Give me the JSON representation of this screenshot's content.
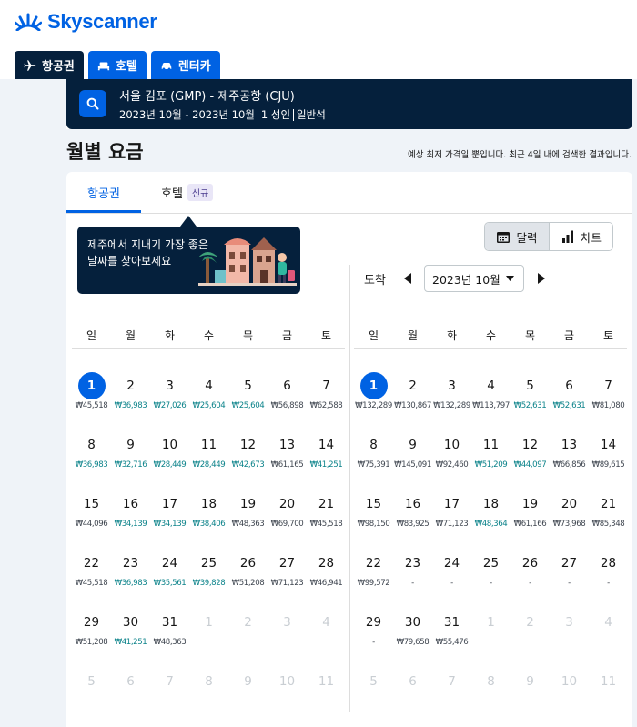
{
  "brand": {
    "name": "Skyscanner",
    "color": "#0062e3"
  },
  "tabs": [
    {
      "label": "항공권",
      "icon": "plane-icon"
    },
    {
      "label": "호텔",
      "icon": "bed-icon"
    },
    {
      "label": "렌터카",
      "icon": "car-icon"
    }
  ],
  "search": {
    "route": "서울 김포 (GMP) - 제주공항 (CJU)",
    "dates": "2023년 10월 - 2023년 10월",
    "passengers": "1 성인",
    "cabin": "일반석"
  },
  "page": {
    "title": "월별 요금",
    "note": "예상 최저 가격일 뿐입니다. 최근 4일 내에 검색한 결과입니다."
  },
  "content_tabs": {
    "flights": "항공권",
    "hotels": "호텔",
    "hotels_badge": "신규"
  },
  "tooltip": {
    "text": "제주에서 지내기 가장 좋은 날짜를 찾아보세요"
  },
  "view_toggle": {
    "calendar": "달력",
    "chart": "차트"
  },
  "arrival": {
    "label": "도착",
    "month": "2023년 10월"
  },
  "weekdays": [
    "일",
    "월",
    "화",
    "수",
    "목",
    "금",
    "토"
  ],
  "calendars": [
    {
      "days": [
        {
          "d": "1",
          "p": "₩45,518",
          "sel": true
        },
        {
          "d": "2",
          "p": "₩36,983",
          "g": true
        },
        {
          "d": "3",
          "p": "₩27,026",
          "g": true
        },
        {
          "d": "4",
          "p": "₩25,604",
          "g": true
        },
        {
          "d": "5",
          "p": "₩25,604",
          "g": true
        },
        {
          "d": "6",
          "p": "₩56,898"
        },
        {
          "d": "7",
          "p": "₩62,588"
        },
        {
          "d": "8",
          "p": "₩36,983",
          "g": true
        },
        {
          "d": "9",
          "p": "₩32,716",
          "g": true
        },
        {
          "d": "10",
          "p": "₩28,449",
          "g": true
        },
        {
          "d": "11",
          "p": "₩28,449",
          "g": true
        },
        {
          "d": "12",
          "p": "₩42,673",
          "g": true
        },
        {
          "d": "13",
          "p": "₩61,165"
        },
        {
          "d": "14",
          "p": "₩41,251",
          "g": true
        },
        {
          "d": "15",
          "p": "₩44,096"
        },
        {
          "d": "16",
          "p": "₩34,139",
          "g": true
        },
        {
          "d": "17",
          "p": "₩34,139",
          "g": true
        },
        {
          "d": "18",
          "p": "₩38,406",
          "g": true
        },
        {
          "d": "19",
          "p": "₩48,363"
        },
        {
          "d": "20",
          "p": "₩69,700"
        },
        {
          "d": "21",
          "p": "₩45,518"
        },
        {
          "d": "22",
          "p": "₩45,518"
        },
        {
          "d": "23",
          "p": "₩36,983",
          "g": true
        },
        {
          "d": "24",
          "p": "₩35,561",
          "g": true
        },
        {
          "d": "25",
          "p": "₩39,828",
          "g": true
        },
        {
          "d": "26",
          "p": "₩51,208"
        },
        {
          "d": "27",
          "p": "₩71,123"
        },
        {
          "d": "28",
          "p": "₩46,941"
        },
        {
          "d": "29",
          "p": "₩51,208"
        },
        {
          "d": "30",
          "p": "₩41,251",
          "g": true
        },
        {
          "d": "31",
          "p": "₩48,363"
        },
        {
          "d": "1",
          "dim": true
        },
        {
          "d": "2",
          "dim": true
        },
        {
          "d": "3",
          "dim": true
        },
        {
          "d": "4",
          "dim": true
        },
        {
          "d": "5",
          "dim": true
        },
        {
          "d": "6",
          "dim": true
        },
        {
          "d": "7",
          "dim": true
        },
        {
          "d": "8",
          "dim": true
        },
        {
          "d": "9",
          "dim": true
        },
        {
          "d": "10",
          "dim": true
        },
        {
          "d": "11",
          "dim": true
        }
      ]
    },
    {
      "days": [
        {
          "d": "1",
          "p": "₩132,289",
          "sel": true
        },
        {
          "d": "2",
          "p": "₩130,867"
        },
        {
          "d": "3",
          "p": "₩132,289"
        },
        {
          "d": "4",
          "p": "₩113,797"
        },
        {
          "d": "5",
          "p": "₩52,631",
          "g": true
        },
        {
          "d": "6",
          "p": "₩52,631",
          "g": true
        },
        {
          "d": "7",
          "p": "₩81,080"
        },
        {
          "d": "8",
          "p": "₩75,391"
        },
        {
          "d": "9",
          "p": "₩145,091"
        },
        {
          "d": "10",
          "p": "₩92,460"
        },
        {
          "d": "11",
          "p": "₩51,209",
          "g": true
        },
        {
          "d": "12",
          "p": "₩44,097",
          "g": true
        },
        {
          "d": "13",
          "p": "₩66,856"
        },
        {
          "d": "14",
          "p": "₩89,615"
        },
        {
          "d": "15",
          "p": "₩98,150"
        },
        {
          "d": "16",
          "p": "₩83,925"
        },
        {
          "d": "17",
          "p": "₩71,123"
        },
        {
          "d": "18",
          "p": "₩48,364",
          "g": true
        },
        {
          "d": "19",
          "p": "₩61,166"
        },
        {
          "d": "20",
          "p": "₩73,968"
        },
        {
          "d": "21",
          "p": "₩85,348"
        },
        {
          "d": "22",
          "p": "₩99,572"
        },
        {
          "d": "23",
          "p": "-"
        },
        {
          "d": "24",
          "p": "-"
        },
        {
          "d": "25",
          "p": "-"
        },
        {
          "d": "26",
          "p": "-"
        },
        {
          "d": "27",
          "p": "-"
        },
        {
          "d": "28",
          "p": "-"
        },
        {
          "d": "29",
          "p": "-"
        },
        {
          "d": "30",
          "p": "₩79,658"
        },
        {
          "d": "31",
          "p": "₩55,476"
        },
        {
          "d": "1",
          "dim": true
        },
        {
          "d": "2",
          "dim": true
        },
        {
          "d": "3",
          "dim": true
        },
        {
          "d": "4",
          "dim": true
        },
        {
          "d": "5",
          "dim": true
        },
        {
          "d": "6",
          "dim": true
        },
        {
          "d": "7",
          "dim": true
        },
        {
          "d": "8",
          "dim": true
        },
        {
          "d": "9",
          "dim": true
        },
        {
          "d": "10",
          "dim": true
        },
        {
          "d": "11",
          "dim": true
        }
      ]
    }
  ]
}
